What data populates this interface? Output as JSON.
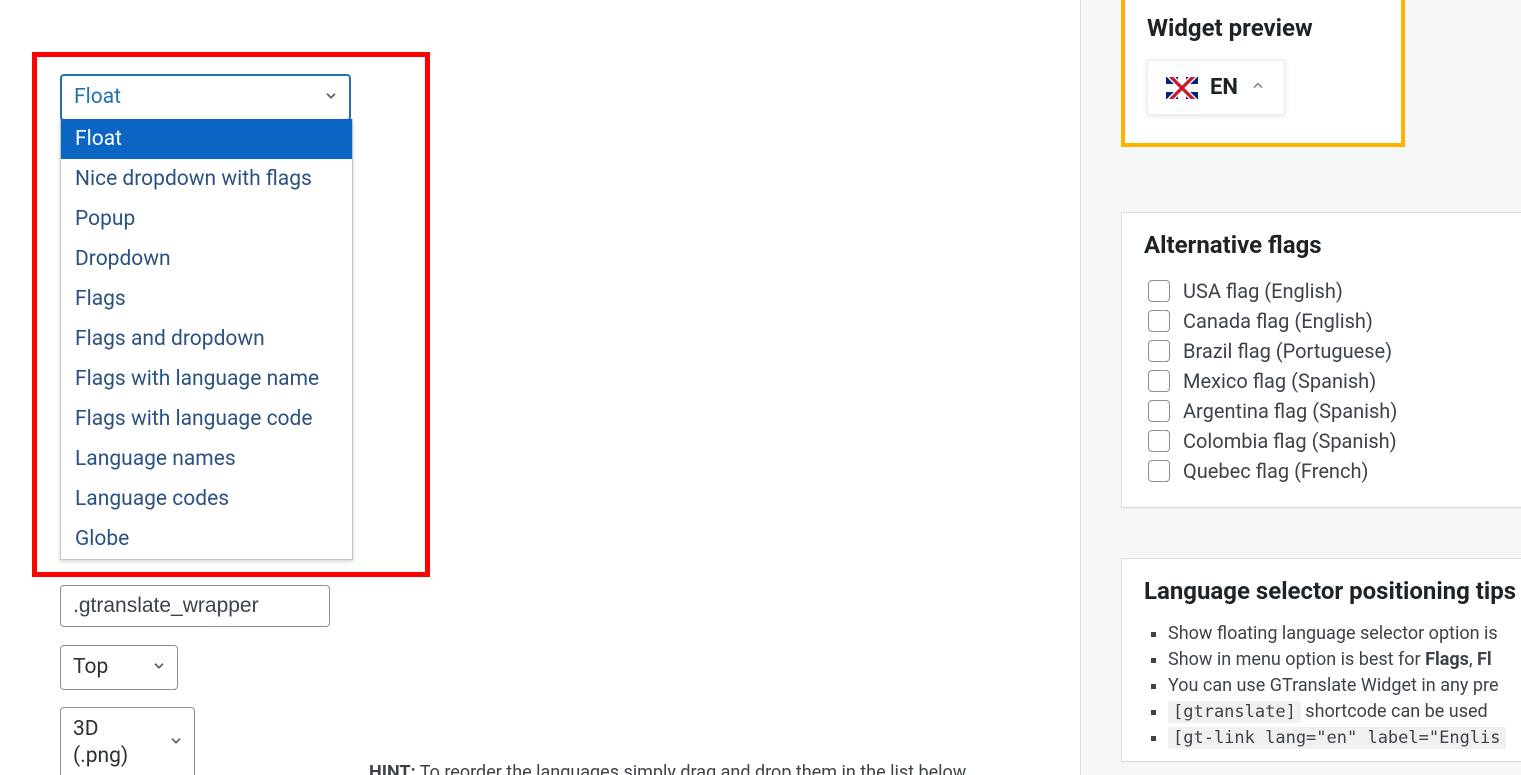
{
  "widget_look_select": {
    "value": "Float",
    "options": [
      "Float",
      "Nice dropdown with flags",
      "Popup",
      "Dropdown",
      "Flags",
      "Flags and dropdown",
      "Flags with language name",
      "Flags with language code",
      "Language names",
      "Language codes",
      "Globe"
    ]
  },
  "wrapper_selector": {
    "value": ".gtranslate_wrapper"
  },
  "position_select": {
    "value": "Top"
  },
  "flag_style_select": {
    "value": "3D (.png)"
  },
  "hint_prefix": "HINT:",
  "hint_rest": " To reorder the languages simply drag and drop them in the list below.",
  "preview": {
    "title": "Widget preview",
    "lang_code": "EN"
  },
  "alt_flags": {
    "title": "Alternative flags",
    "items": [
      "USA flag (English)",
      "Canada flag (English)",
      "Brazil flag (Portuguese)",
      "Mexico flag (Spanish)",
      "Argentina flag (Spanish)",
      "Colombia flag (Spanish)",
      "Quebec flag (French)"
    ]
  },
  "tips": {
    "title": "Language selector positioning tips",
    "line1_a": "Show floating language selector option is",
    "line2_a": "Show in menu option is best for ",
    "line2_b1": "Flags",
    "line2_sep": ", ",
    "line2_b2": "Fl",
    "line3": "You can use GTranslate Widget in any pre",
    "line4_code": "[gtranslate]",
    "line4_rest": " shortcode can be used",
    "line5_code": "[gt-link lang=\"en\" label=\"Englis"
  }
}
